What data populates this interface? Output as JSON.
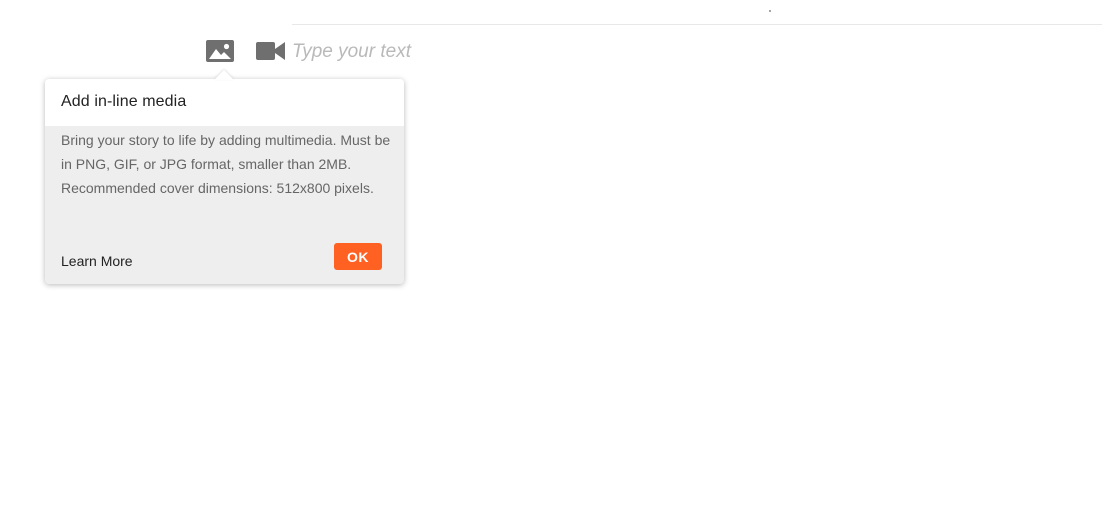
{
  "editor": {
    "placeholder": "Type your text",
    "toolbar": {
      "image_icon": "image-icon",
      "video_icon": "video-camera-icon"
    }
  },
  "popover": {
    "title": "Add in-line media",
    "body": "Bring your story to life by adding multimedia. Must be in PNG, GIF, or JPG format, smaller than 2MB. Recommended cover dimensions: 512x800 pixels.",
    "learn_more_label": "Learn More",
    "ok_label": "OK"
  },
  "colors": {
    "accent": "#ff6122",
    "icon": "#6f6f6f",
    "placeholder": "#b9b9b9",
    "popover_bg": "#eeeeee"
  }
}
